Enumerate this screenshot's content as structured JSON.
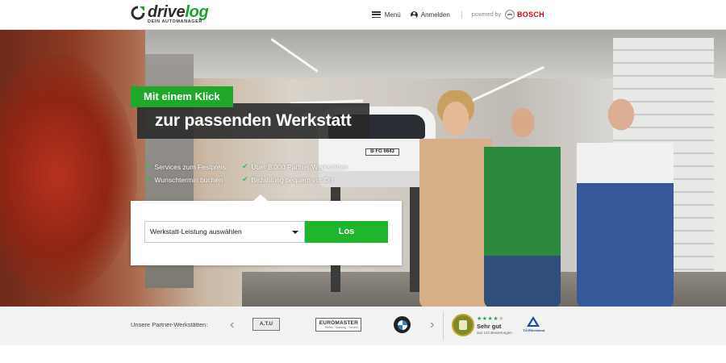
{
  "header": {
    "logo": {
      "word_1": "drive",
      "word_2": "log",
      "tagline": "DEIN AUTOMANAGER"
    },
    "nav": {
      "menu_label": "Menü",
      "login_label": "Anmelden",
      "powered_by": "powered by",
      "brand": "BOSCH"
    }
  },
  "hero": {
    "headline_1": "Mit einem Klick",
    "headline_2": "zur passenden Werkstatt",
    "license_plate": "B·FG 6643",
    "features": [
      "Services zum Festpreis",
      "Über 8.000 Partner Werkstätten",
      "Wunschtermin buchen",
      "Bezahlung bequem vor Ort"
    ],
    "search": {
      "select_value": "Werkstatt-Leistung auswählen",
      "button_label": "Los"
    }
  },
  "partners": {
    "label": "Unsere Partner-Werkstätten:",
    "prev_arrow": "‹",
    "next_arrow": "›",
    "logos": {
      "atu": "A.T.U",
      "euromaster_name": "EUROMASTER",
      "euromaster_sub": "Reifen · Wartung · Service"
    },
    "rating": {
      "stars_filled": "★★★★",
      "stars_empty": "★",
      "text": "Sehr gut",
      "count": "aus 142 Bewertungen"
    },
    "tuv_label": "TÜVRheinland"
  },
  "colors": {
    "brand_green": "#1fa82a",
    "button_green": "#1fb52c",
    "bosch_red": "#e20015",
    "headline_dark": "#282828"
  },
  "icons": [
    "logo-mark-icon",
    "hamburger-menu-icon",
    "user-icon",
    "bosch-icon",
    "checkmark-icon",
    "chevron-down-icon",
    "chevron-left-icon",
    "chevron-right-icon",
    "bmw-logo-icon",
    "rating-seal-icon",
    "tuv-logo-icon"
  ]
}
